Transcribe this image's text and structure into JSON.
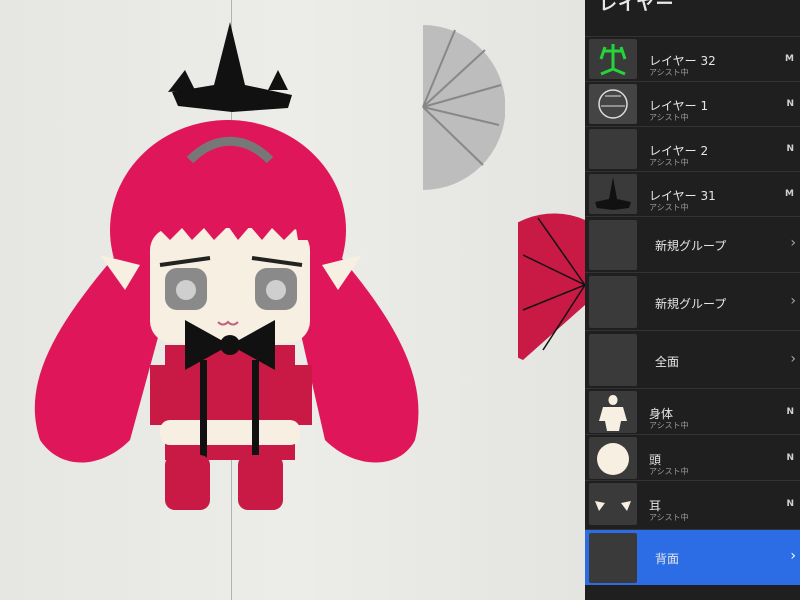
{
  "panel": {
    "title": "レイヤー",
    "layers": [
      {
        "name": "レイヤー 32",
        "sub": "アシスト中",
        "blend": "M"
      },
      {
        "name": "レイヤー 1",
        "sub": "アシスト中",
        "blend": "N"
      },
      {
        "name": "レイヤー 2",
        "sub": "アシスト中",
        "blend": "N"
      },
      {
        "name": "レイヤー 31",
        "sub": "アシスト中",
        "blend": "M"
      }
    ],
    "groups": [
      {
        "name": "新規グループ"
      },
      {
        "name": "新規グループ"
      },
      {
        "name": "全面"
      }
    ],
    "parts": [
      {
        "name": "身体",
        "sub": "アシスト中",
        "blend": "N"
      },
      {
        "name": "頭",
        "sub": "アシスト中",
        "blend": "N"
      },
      {
        "name": "耳",
        "sub": "アシスト中",
        "blend": "N"
      }
    ],
    "selected_group": {
      "name": "背面"
    }
  },
  "colors": {
    "hair": "#e0165a",
    "skin": "#f6efe2",
    "dress": "#c81a44",
    "selected": "#2c6de6",
    "panel_bg": "#1f1f1f"
  }
}
